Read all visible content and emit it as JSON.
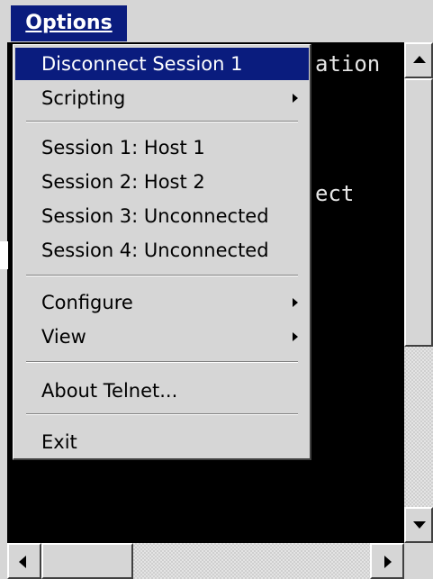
{
  "menubar": {
    "options_label": "Options"
  },
  "terminal": {
    "line1": "ation",
    "line2": "ect"
  },
  "menu": {
    "disconnect": "Disconnect Session 1",
    "scripting": "Scripting",
    "session1": "Session 1: Host 1",
    "session2": "Session 2: Host 2",
    "session3": "Session 3: Unconnected",
    "session4": "Session 4: Unconnected",
    "configure": "Configure",
    "view": "View",
    "about": "About Telnet...",
    "exit": "Exit"
  },
  "colors": {
    "highlight": "#0a1c7e",
    "face": "#d6d6d6",
    "terminal_bg": "#000000"
  },
  "icons": [
    "up-arrow-icon",
    "down-arrow-icon",
    "left-arrow-icon",
    "right-arrow-icon",
    "submenu-arrow-icon"
  ]
}
